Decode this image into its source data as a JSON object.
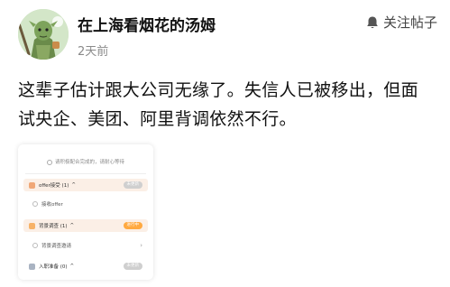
{
  "post": {
    "author": "在上海看烟花的汤姆",
    "time": "2天前",
    "follow_label": "关注帖子",
    "content": "这辈子估计跟大公司无缘了。失信人已被移出，但面试央企、美团、阿里背调依然不行。"
  },
  "screenshot_card": {
    "tip": "请积极配合完成的，请耐心等待",
    "sections": [
      {
        "label": "offer接受 (1)",
        "chevron": "^",
        "badge": "未更新",
        "badge_color": "#cfcfcf",
        "dot_color": "#f0a777",
        "sub": "接收offer"
      },
      {
        "label": "背景调查 (1)",
        "chevron": "^",
        "badge": "进行中",
        "badge_color": "#ffa940",
        "dot_color": "#f7b267",
        "sub": "背景调查邀请"
      },
      {
        "label": "入职准备 (0)",
        "chevron": "^",
        "badge": "未更新",
        "badge_color": "#cfcfcf",
        "dot_color": "#a9b3c2",
        "sub": ""
      }
    ]
  },
  "icons": {
    "follow": "bell-icon",
    "avatar": "avatar-character-image"
  },
  "colors": {
    "author": "#111111",
    "time": "#8a8a8a",
    "highlight_bg": "#fbefe6"
  }
}
